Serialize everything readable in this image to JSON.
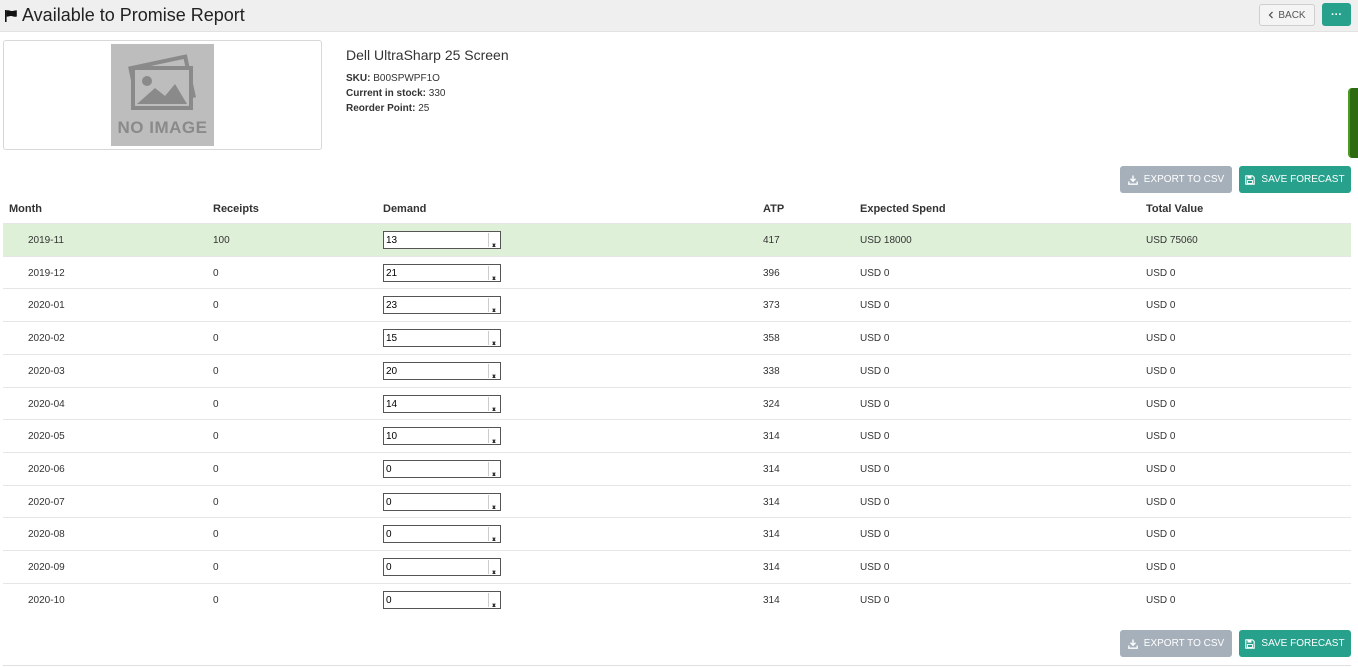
{
  "header": {
    "title": "Available to Promise Report",
    "back_label": "BACK",
    "more_label": "···"
  },
  "product": {
    "image_placeholder": "NO IMAGE",
    "name": "Dell UltraSharp 25 Screen",
    "sku_label": "SKU:",
    "sku": "B00SPWPF1O",
    "stock_label": "Current in stock:",
    "stock": "330",
    "reorder_label": "Reorder Point:",
    "reorder": "25"
  },
  "actions": {
    "export_label": "EXPORT TO CSV",
    "save_label": "SAVE FORECAST"
  },
  "table": {
    "columns": [
      "Month",
      "Receipts",
      "Demand",
      "ATP",
      "Expected Spend",
      "Total Value"
    ],
    "rows": [
      {
        "month": "2019-11",
        "receipts": "100",
        "demand": "13",
        "atp": "417",
        "spend": "USD 18000",
        "total": "USD 75060"
      },
      {
        "month": "2019-12",
        "receipts": "0",
        "demand": "21",
        "atp": "396",
        "spend": "USD 0",
        "total": "USD 0"
      },
      {
        "month": "2020-01",
        "receipts": "0",
        "demand": "23",
        "atp": "373",
        "spend": "USD 0",
        "total": "USD 0"
      },
      {
        "month": "2020-02",
        "receipts": "0",
        "demand": "15",
        "atp": "358",
        "spend": "USD 0",
        "total": "USD 0"
      },
      {
        "month": "2020-03",
        "receipts": "0",
        "demand": "20",
        "atp": "338",
        "spend": "USD 0",
        "total": "USD 0"
      },
      {
        "month": "2020-04",
        "receipts": "0",
        "demand": "14",
        "atp": "324",
        "spend": "USD 0",
        "total": "USD 0"
      },
      {
        "month": "2020-05",
        "receipts": "0",
        "demand": "10",
        "atp": "314",
        "spend": "USD 0",
        "total": "USD 0"
      },
      {
        "month": "2020-06",
        "receipts": "0",
        "demand": "0",
        "atp": "314",
        "spend": "USD 0",
        "total": "USD 0"
      },
      {
        "month": "2020-07",
        "receipts": "0",
        "demand": "0",
        "atp": "314",
        "spend": "USD 0",
        "total": "USD 0"
      },
      {
        "month": "2020-08",
        "receipts": "0",
        "demand": "0",
        "atp": "314",
        "spend": "USD 0",
        "total": "USD 0"
      },
      {
        "month": "2020-09",
        "receipts": "0",
        "demand": "0",
        "atp": "314",
        "spend": "USD 0",
        "total": "USD 0"
      },
      {
        "month": "2020-10",
        "receipts": "0",
        "demand": "0",
        "atp": "314",
        "spend": "USD 0",
        "total": "USD 0"
      }
    ]
  },
  "colors": {
    "accent": "#27a08c",
    "export_disabled": "#a6b0bb",
    "highlight_row": "#dff0d8",
    "side_tab": "#2d6a12"
  },
  "icons": {
    "title": "flag-icon",
    "back": "chevron-left-icon",
    "export": "download-icon",
    "save": "floppy-disk-icon",
    "placeholder": "image-placeholder-icon"
  }
}
